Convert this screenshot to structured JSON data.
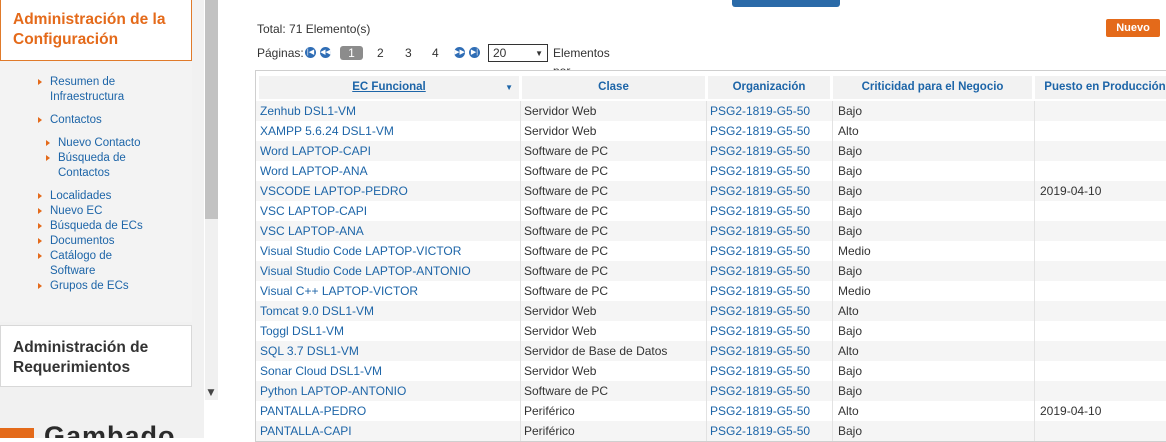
{
  "sidebar": {
    "config_title": "Administración de la Configuración",
    "menu": [
      "Resumen de Infraestructura",
      "Contactos",
      "Nuevo Contacto",
      "Búsqueda de Contactos",
      "Localidades",
      "Nuevo EC",
      "Búsqueda de ECs",
      "Documentos",
      "Catálogo de Software",
      "Grupos de ECs"
    ],
    "requirements_title": "Administración de Requerimientos",
    "brand": "Gambado"
  },
  "main": {
    "total_label": "Total: 71 Elemento(s)",
    "new_button": "Nuevo",
    "pager": {
      "label": "Páginas:",
      "pages": [
        "1",
        "2",
        "3",
        "4"
      ],
      "current": "1",
      "per_page": "20",
      "per_page_label": "Elementos por Página"
    }
  },
  "table": {
    "columns": [
      "EC Funcional",
      "Clase",
      "Organización",
      "Criticidad para el Negocio",
      "Puesto en Producción"
    ],
    "rows": [
      [
        "Zenhub DSL1-VM",
        "Servidor Web",
        "PSG2-1819-G5-50",
        "Bajo",
        ""
      ],
      [
        "XAMPP 5.6.24 DSL1-VM",
        "Servidor Web",
        "PSG2-1819-G5-50",
        "Alto",
        ""
      ],
      [
        "Word LAPTOP-CAPI",
        "Software de PC",
        "PSG2-1819-G5-50",
        "Bajo",
        ""
      ],
      [
        "Word LAPTOP-ANA",
        "Software de PC",
        "PSG2-1819-G5-50",
        "Bajo",
        ""
      ],
      [
        "VSCODE LAPTOP-PEDRO",
        "Software de PC",
        "PSG2-1819-G5-50",
        "Bajo",
        "2019-04-10"
      ],
      [
        "VSC LAPTOP-CAPI",
        "Software de PC",
        "PSG2-1819-G5-50",
        "Bajo",
        ""
      ],
      [
        "VSC LAPTOP-ANA",
        "Software de PC",
        "PSG2-1819-G5-50",
        "Bajo",
        ""
      ],
      [
        "Visual Studio Code LAPTOP-VICTOR",
        "Software de PC",
        "PSG2-1819-G5-50",
        "Medio",
        ""
      ],
      [
        "Visual Studio Code LAPTOP-ANTONIO",
        "Software de PC",
        "PSG2-1819-G5-50",
        "Bajo",
        ""
      ],
      [
        "Visual C++ LAPTOP-VICTOR",
        "Software de PC",
        "PSG2-1819-G5-50",
        "Medio",
        ""
      ],
      [
        "Tomcat 9.0 DSL1-VM",
        "Servidor Web",
        "PSG2-1819-G5-50",
        "Alto",
        ""
      ],
      [
        "Toggl DSL1-VM",
        "Servidor Web",
        "PSG2-1819-G5-50",
        "Bajo",
        ""
      ],
      [
        "SQL 3.7 DSL1-VM",
        "Servidor de Base de Datos",
        "PSG2-1819-G5-50",
        "Alto",
        ""
      ],
      [
        "Sonar Cloud DSL1-VM",
        "Servidor Web",
        "PSG2-1819-G5-50",
        "Bajo",
        ""
      ],
      [
        "Python LAPTOP-ANTONIO",
        "Software de PC",
        "PSG2-1819-G5-50",
        "Bajo",
        ""
      ],
      [
        "PANTALLA-PEDRO",
        "Periférico",
        "PSG2-1819-G5-50",
        "Alto",
        "2019-04-10"
      ],
      [
        "PANTALLA-CAPI",
        "Periférico",
        "PSG2-1819-G5-50",
        "Bajo",
        ""
      ]
    ]
  }
}
